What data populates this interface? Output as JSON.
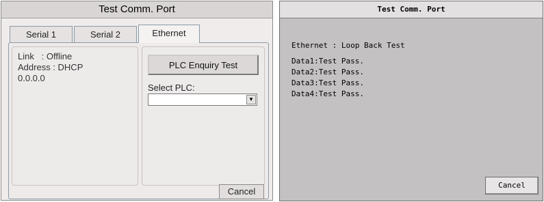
{
  "left_window": {
    "title": "Test Comm. Port",
    "tabs": [
      {
        "label": "Serial 1"
      },
      {
        "label": "Serial 2"
      },
      {
        "label": "Ethernet",
        "selected": true
      }
    ],
    "status": {
      "link_line": "Link   : Offline",
      "address_line": "Address : DHCP",
      "ip": "0.0.0.0"
    },
    "plc_enquiry_button": "PLC Enquiry Test",
    "select_plc_label": "Select PLC:",
    "select_plc_value": "",
    "cancel_button": "Cancel"
  },
  "right_window": {
    "title": "Test Comm. Port",
    "heading": "Ethernet : Loop Back Test",
    "results": [
      "Data1:Test Pass.",
      "Data2:Test Pass.",
      "Data3:Test Pass.",
      "Data4:Test Pass."
    ],
    "cancel_button": "Cancel"
  },
  "colors": {
    "left_background": "#f0ecec",
    "right_background": "#c3c1c1",
    "tab_border": "#8a9aa5"
  },
  "icons": {
    "select_arrow": "dropdown-arrow-icon"
  }
}
